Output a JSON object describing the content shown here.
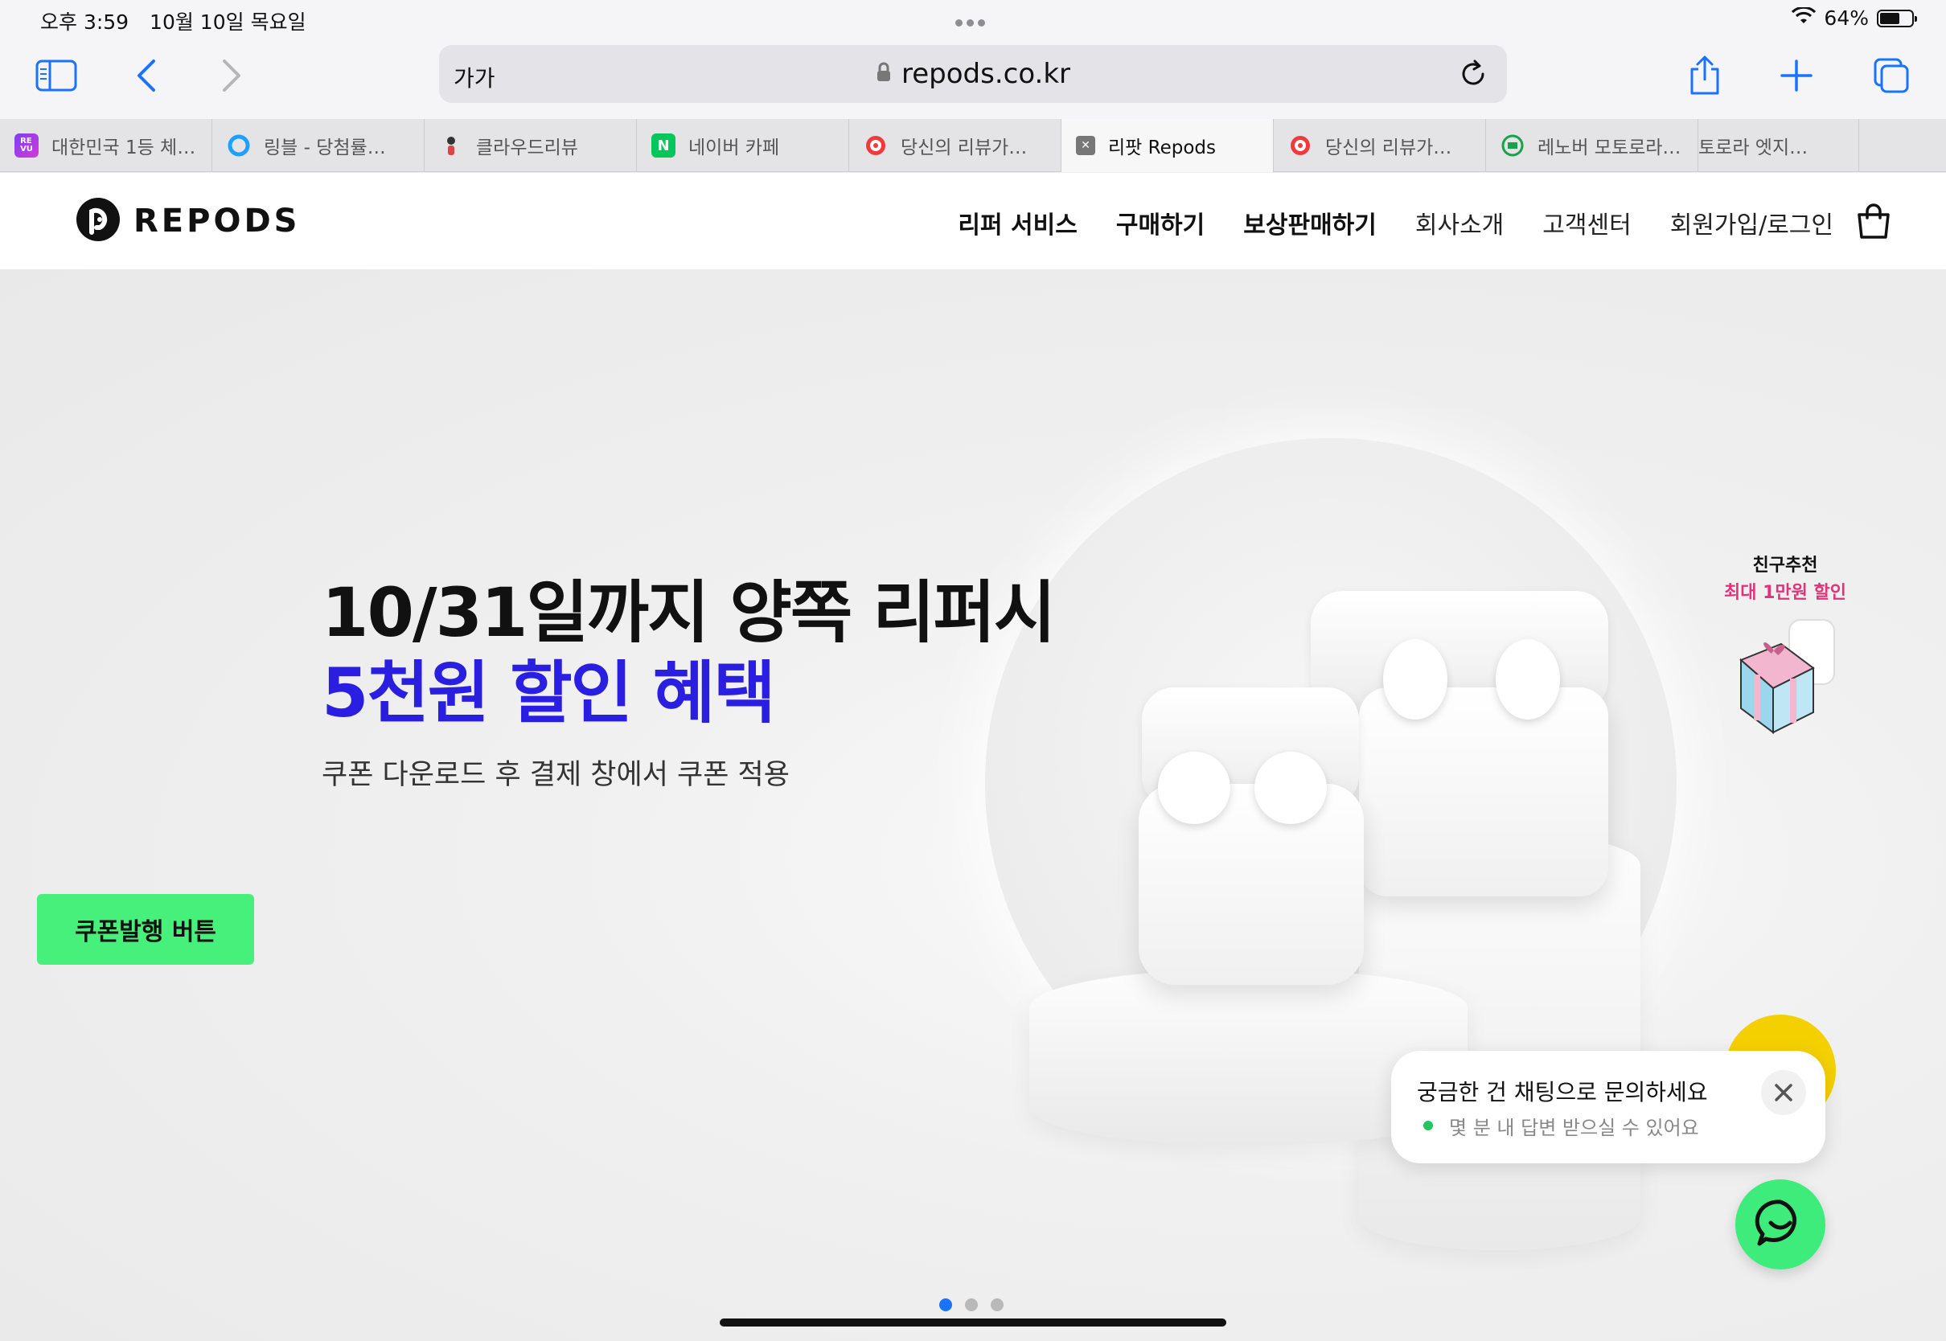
{
  "status_bar": {
    "time": "오후 3:59",
    "date": "10월 10일 목요일",
    "battery_text": "64%",
    "battery_level": 0.64
  },
  "browser": {
    "text_size_label": "가가",
    "url": "repods.co.kr",
    "icons": [
      "sidebar-icon",
      "back-icon",
      "forward-icon",
      "lock-icon",
      "reload-icon",
      "share-icon",
      "new-tab-icon",
      "tabs-icon"
    ]
  },
  "tabs": [
    {
      "title": "대한민국 1등 체…",
      "favicon_color": "#7b3ff2",
      "favicon_text": "RE VU"
    },
    {
      "title": "링블 - 당첨률…",
      "favicon_color": "#ffffff",
      "favicon_text": ""
    },
    {
      "title": "클라우드리뷰",
      "favicon_color": "#ffffff",
      "favicon_text": ""
    },
    {
      "title": "네이버 카페",
      "favicon_color": "#03c75a",
      "favicon_text": "N"
    },
    {
      "title": "당신의 리뷰가…",
      "favicon_color": "#ef3b3b",
      "favicon_text": ""
    },
    {
      "title": "리팟 Repods",
      "favicon_color": "#777777",
      "favicon_text": "✕",
      "active": true
    },
    {
      "title": "당신의 리뷰가…",
      "favicon_color": "#ef3b3b",
      "favicon_text": ""
    },
    {
      "title": "레노버 모토로라…",
      "favicon_color": "#16a34a",
      "favicon_text": ""
    },
    {
      "title": "토로라 엣지…",
      "favicon_color": "",
      "favicon_text": ""
    }
  ],
  "site": {
    "logo_text": "REPODS",
    "nav": [
      {
        "label": "리퍼 서비스",
        "bold": true
      },
      {
        "label": "구매하기",
        "bold": true
      },
      {
        "label": "보상판매하기",
        "bold": true
      },
      {
        "label": "회사소개",
        "bold": false
      },
      {
        "label": "고객센터",
        "bold": false
      },
      {
        "label": "회원가입/로그인",
        "bold": false
      }
    ]
  },
  "hero": {
    "headline_line1": "10/31일까지 양쪽 리퍼시",
    "headline_line2": "5천원 할인 혜택",
    "subcopy": "쿠폰 다운로드 후 결제 창에서 쿠폰 적용",
    "coupon_button": "쿠폰발행 버튼",
    "accent_color": "#2a1fe0",
    "button_color": "#47f07a",
    "slide_count": 3,
    "active_slide": 1
  },
  "referral": {
    "line1": "친구추천",
    "line2": "최대 1만원 할인"
  },
  "chat": {
    "tooltip_title": "궁금한 건 채팅으로 문의하세요",
    "tooltip_sub": "몇 분 내 답변 받으실 수 있어요",
    "button_color": "#3dec7b"
  }
}
